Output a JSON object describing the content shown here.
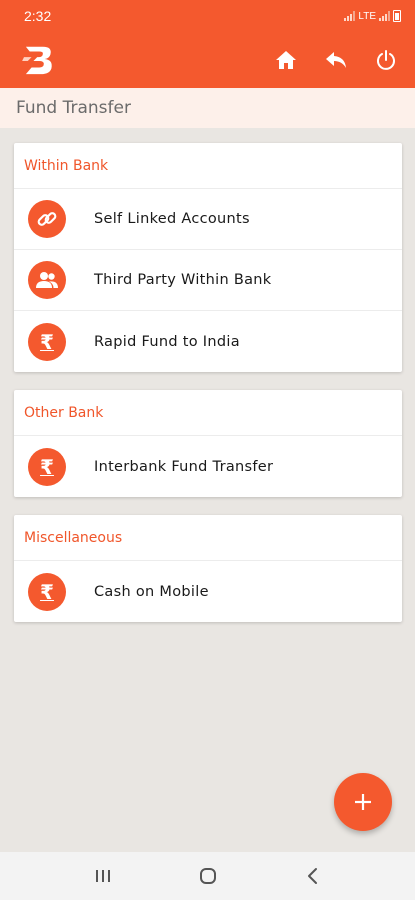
{
  "status_bar": {
    "time": "2:32",
    "network_label": "LTE"
  },
  "app_bar": {
    "logo_icon": "bank-logo-icon",
    "actions": [
      {
        "icon": "home-icon"
      },
      {
        "icon": "back-arrow-icon"
      },
      {
        "icon": "power-icon"
      }
    ]
  },
  "page": {
    "title": "Fund Transfer"
  },
  "sections": [
    {
      "title": "Within Bank",
      "items": [
        {
          "label": "Self Linked Accounts",
          "icon": "link-icon"
        },
        {
          "label": "Third Party Within Bank",
          "icon": "users-icon"
        },
        {
          "label": "Rapid Fund to India",
          "icon": "rupee-icon"
        }
      ]
    },
    {
      "title": "Other Bank",
      "items": [
        {
          "label": "Interbank Fund Transfer",
          "icon": "rupee-icon"
        }
      ]
    },
    {
      "title": "Miscellaneous",
      "items": [
        {
          "label": "Cash on Mobile",
          "icon": "rupee-icon"
        }
      ]
    }
  ],
  "fab": {
    "icon": "plus-icon"
  },
  "nav_bar": {
    "buttons": [
      {
        "icon": "recent-apps-icon"
      },
      {
        "icon": "home-circle-icon"
      },
      {
        "icon": "back-chevron-icon"
      }
    ]
  },
  "colors": {
    "accent": "#f4592e",
    "section_title": "#f0562b",
    "background": "#e9e6e2"
  }
}
